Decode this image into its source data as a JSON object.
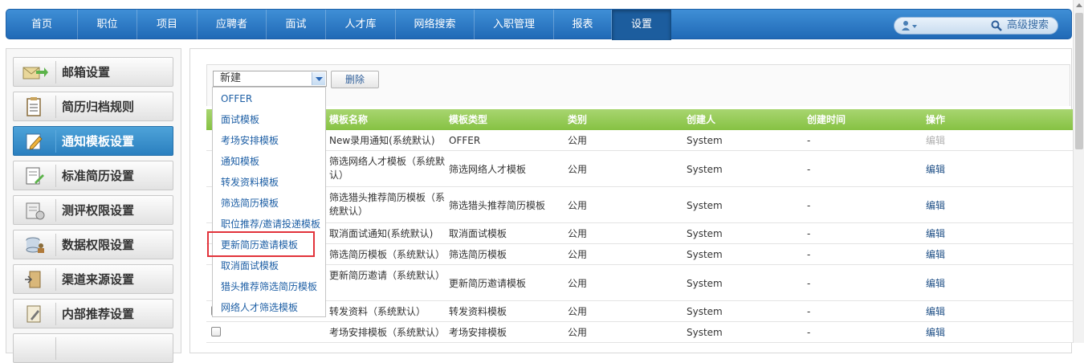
{
  "nav": {
    "items": [
      "首页",
      "职位",
      "项目",
      "应聘者",
      "面试",
      "人才库",
      "网络搜索",
      "入职管理",
      "报表",
      "设置"
    ],
    "active_index": 9,
    "advanced_search": "高级搜索"
  },
  "sidebar": {
    "items": [
      {
        "label": "邮箱设置",
        "icon": "mailbox-icon"
      },
      {
        "label": "简历归档规则",
        "icon": "clipboard-icon"
      },
      {
        "label": "通知模板设置",
        "icon": "edit-note-icon"
      },
      {
        "label": "标准简历设置",
        "icon": "resume-edit-icon"
      },
      {
        "label": "测评权限设置",
        "icon": "assessment-icon"
      },
      {
        "label": "数据权限设置",
        "icon": "database-user-icon"
      },
      {
        "label": "渠道来源设置",
        "icon": "door-exit-icon"
      },
      {
        "label": "内部推荐设置",
        "icon": "document-pen-icon"
      }
    ],
    "active_index": 2
  },
  "toolbar": {
    "select_value": "新建",
    "delete_label": "删除"
  },
  "dropdown": {
    "options": [
      "OFFER",
      "面试模板",
      "考场安排模板",
      "通知模板",
      "转发资料模板",
      "筛选简历模板",
      "职位推荐/邀请投递模板",
      "更新简历邀请模板",
      "取消面试模板",
      "猎头推荐筛选简历模板",
      "网络人才筛选模板"
    ],
    "highlighted_index": 7
  },
  "table": {
    "headers": [
      "模板名称",
      "模板类型",
      "类别",
      "创建人",
      "创建时间",
      "操作"
    ],
    "rows": [
      {
        "name": "New录用通知(系统默认)",
        "type": "OFFER",
        "category": "公用",
        "creator": "System",
        "created": "-",
        "action": "编辑",
        "action_disabled": true
      },
      {
        "name": "筛选网络人才模板（系统默认）",
        "type": "筛选网络人才模板",
        "category": "公用",
        "creator": "System",
        "created": "-",
        "action": "编辑"
      },
      {
        "name": "筛选猎头推荐简历模板（系统默认）",
        "type": "筛选猎头推荐简历模板",
        "category": "公用",
        "creator": "System",
        "created": "-",
        "action": "编辑"
      },
      {
        "name": "取消面试通知(系统默认)",
        "type": "取消面试模板",
        "category": "公用",
        "creator": "System",
        "created": "-",
        "action": "编辑"
      },
      {
        "name": "筛选简历模板（系统默认）",
        "type": "筛选简历模板",
        "category": "公用",
        "creator": "System",
        "created": "-",
        "action": "编辑"
      },
      {
        "name": "更新简历邀请（系统默认）",
        "type": "更新简历邀请模板",
        "category": "公用",
        "creator": "System",
        "created": "-",
        "action": "编辑"
      },
      {
        "name": "转发资料（系统默认）",
        "type": "转发资料模板",
        "category": "公用",
        "creator": "System",
        "created": "-",
        "action": "编辑"
      },
      {
        "name": "考场安排模板（系统默认）",
        "type": "考场安排模板",
        "category": "公用",
        "creator": "System",
        "created": "-",
        "action": "编辑"
      }
    ]
  }
}
